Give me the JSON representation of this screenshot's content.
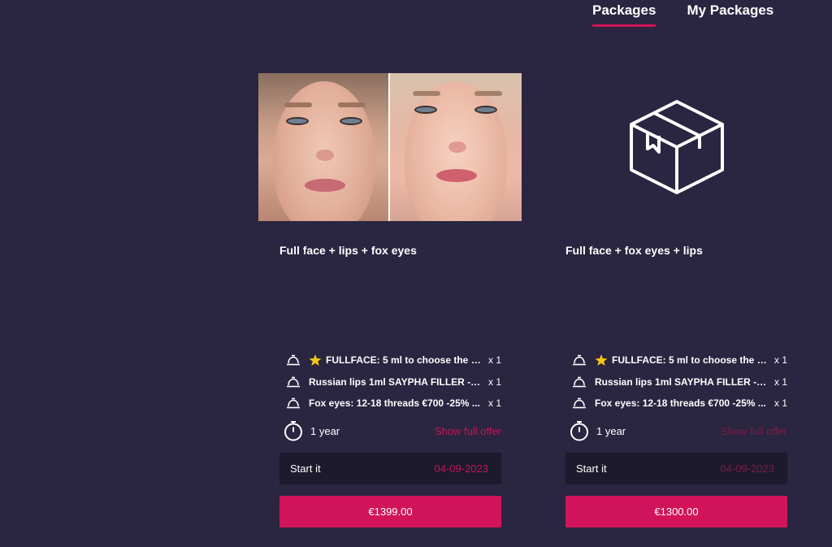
{
  "tabs": [
    {
      "label": "Packages",
      "active": true
    },
    {
      "label": "My Packages",
      "active": false
    }
  ],
  "accent_color": "#d1145a",
  "packages": [
    {
      "image": "before-after-face-photo",
      "title": "Full face + lips + fox eyes",
      "items": [
        {
          "icon": "star-icon",
          "name": "FULLFACE: 5 ml to choose the a...",
          "qty": "x 1"
        },
        {
          "icon": null,
          "name": "Russian lips 1ml SAYPHA FILLER -2...",
          "qty": "x 1"
        },
        {
          "icon": null,
          "name": "Fox eyes: 12-18 threads €700 -25% ...",
          "qty": "x 1"
        }
      ],
      "duration": "1 year",
      "show_offer_label": "Show full offer",
      "start_label": "Start it",
      "start_date": "04-09-2023",
      "price": "€1399.00"
    },
    {
      "image": "box-icon",
      "title": "Full face + fox eyes + lips",
      "items": [
        {
          "icon": "star-icon",
          "name": "FULLFACE: 5 ml to choose the a...",
          "qty": "x 1"
        },
        {
          "icon": null,
          "name": "Russian lips 1ml SAYPHA FILLER -2...",
          "qty": "x 1"
        },
        {
          "icon": null,
          "name": "Fox eyes: 12-18 threads €700 -25% ...",
          "qty": "x 1"
        }
      ],
      "duration": "1 year",
      "show_offer_label": "Show full offer",
      "start_label": "Start it",
      "start_date": "04-09-2023",
      "price": "€1300.00"
    }
  ]
}
